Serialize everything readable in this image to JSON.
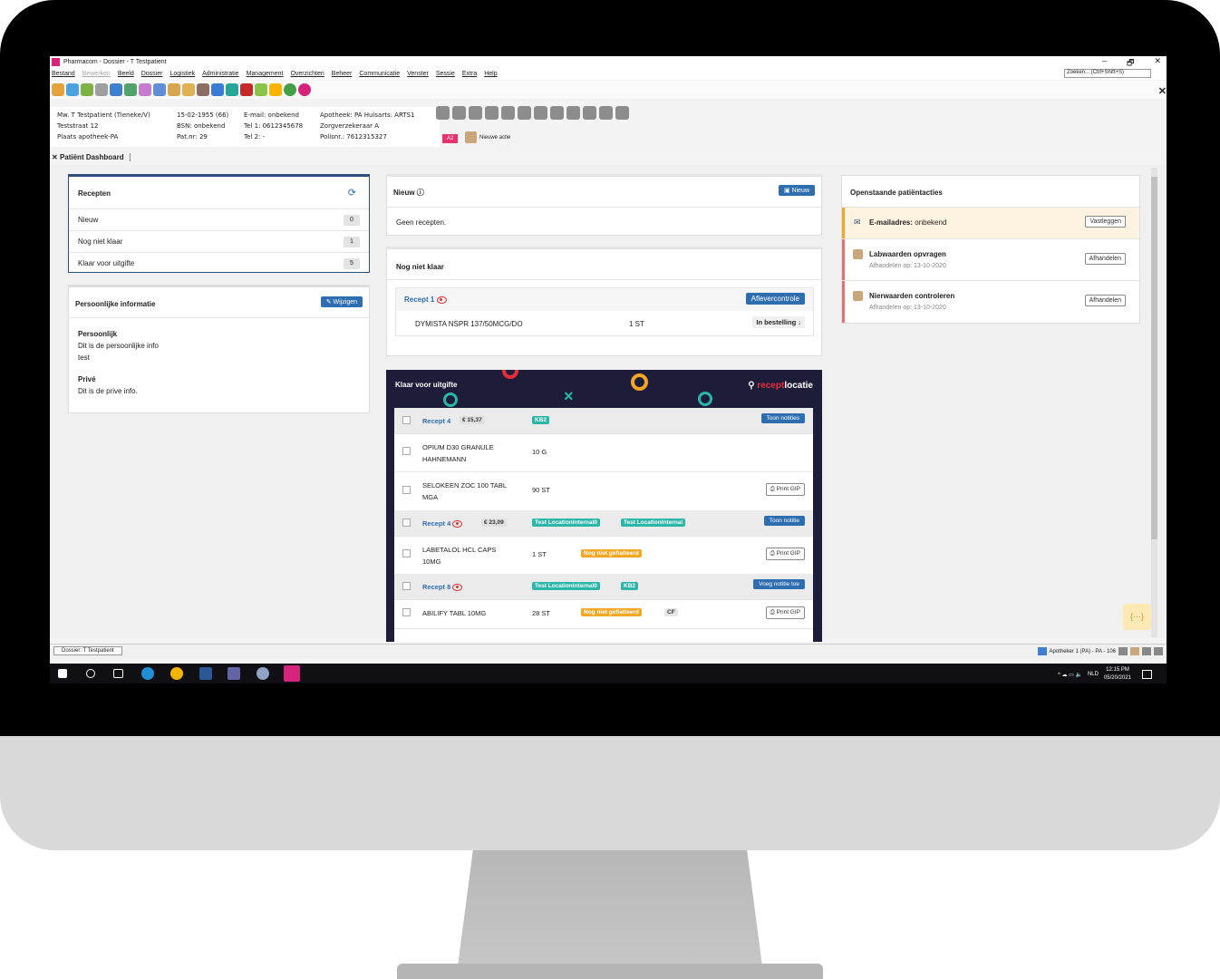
{
  "window": {
    "title": "Pharmacom - Dossier - T Testpatient",
    "min": "–",
    "max": "🗗",
    "close": "✕",
    "close_tab": "✕"
  },
  "menu": [
    "Bestand",
    "Bewerken",
    "Beeld",
    "Dossier",
    "Logistiek",
    "Administratie",
    "Management",
    "Overzichten",
    "Beheer",
    "Communicatie",
    "Venster",
    "Sessie",
    "Extra",
    "Help"
  ],
  "search": {
    "placeholder": "Zoeken... (Ctrl+Shift+S)"
  },
  "patient": {
    "name": "Mw. T Testpatient (Tieneke/V)",
    "street": "Teststraat 12",
    "city": "Plaats apotheek-PA",
    "dob": "15-02-1955 (66)",
    "bsn": "BSN: onbekend",
    "patnr": "Pat.nr: 29",
    "email": "E-mail: onbekend",
    "tel1": "Tel 1: 0612345678",
    "tel2": "Tel 2: -",
    "pharmacy": "Apotheek: PA Huisarts: ARTS1",
    "insurer": "Zorgverzekeraar A",
    "polis": "Polisnr.: 7612315327",
    "badge": "A2",
    "new_action": "Nieuwe actie"
  },
  "tab": {
    "close": "✕",
    "label": "Patiënt Dashboard"
  },
  "recepten": {
    "title": "Recepten",
    "refresh_icon": "⟳",
    "rows": [
      {
        "label": "Nieuw",
        "count": "0"
      },
      {
        "label": "Nog niet klaar",
        "count": "1"
      },
      {
        "label": "Klaar voor uitgifte",
        "count": "5"
      }
    ]
  },
  "personal": {
    "title": "Persoonlijke informatie",
    "edit": "✎ Wijzigen",
    "sec1_title": "Persoonlijk",
    "sec1_line1": "Dit is de persoonlijke info",
    "sec1_line2": "test",
    "sec2_title": "Privé",
    "sec2_line1": "Dit is de prive info."
  },
  "nieuw": {
    "title": "Nieuw ⓘ",
    "button": "▣ Nieuw",
    "empty": "Geen recepten."
  },
  "notready": {
    "title": "Nog niet klaar",
    "recept": "Recept 1",
    "button": "Aflevercontrole",
    "drug": "DYMISTA NSPR 137/50MCG/DO",
    "qty": "1 ST",
    "status": "In bestelling ↓"
  },
  "ready": {
    "title": "Klaar voor uitgifte",
    "brand_a": "recept",
    "brand_b": "locatie",
    "pin": "⚲",
    "rows": {
      "r1": {
        "recept": "Recept 4",
        "price": "€ 15,37",
        "badge": "KB2",
        "btn": "Toon notities"
      },
      "d1": {
        "name1": "OPIUM D30 GRANULE",
        "name2": "HAHNEMANN",
        "qty": "10 G"
      },
      "d2": {
        "name1": "SELOKEEN ZOC 100 TABL",
        "name2": "MGA",
        "qty": "90 ST",
        "btn": "⎙ Print GIP"
      },
      "r2": {
        "recept": "Recept 4",
        "price": "€ 23,09",
        "badge1": "Test LocationInternal0",
        "badge2": "Test LocationInternal",
        "btn": "Toon notitie"
      },
      "d3": {
        "name1": "LABETALOL HCL CAPS",
        "name2": "10MG",
        "qty": "1 ST",
        "status": "Nog niet gefiatteerd",
        "btn": "⎙ Print GIP"
      },
      "r3": {
        "recept": "Recept 8",
        "badge1": "Test LocationInternal0",
        "badge2": "KB2",
        "btn": "Voeg notitie toe"
      },
      "d4": {
        "name1": "ABILIFY TABL 10MG",
        "qty": "28 ST",
        "status": "Nog niet gefiatteerd",
        "cf": "CF",
        "btn": "⎙ Print GIP"
      }
    }
  },
  "actions": {
    "title": "Openstaande patiëntacties",
    "items": [
      {
        "label": "E-mailadres:",
        "value": " onbekend",
        "btn": "Vastleggen",
        "color": "#f5a623"
      },
      {
        "label": "Labwaarden opvragen",
        "sub": "Afhandelen op: 13-10-2020",
        "btn": "Afhandelen",
        "color": "#e8706a"
      },
      {
        "label": "Nierwaarden controleren",
        "sub": "Afhandelen op: 13-10-2020",
        "btn": "Afhandelen",
        "color": "#e8706a"
      }
    ]
  },
  "snippet": "{···}",
  "status": {
    "tab": "Dossier: T Testpatient",
    "right": "Apotheker 1 (PA) - PA - 106"
  },
  "taskbar": {
    "lang": "NLD",
    "time": "12:15 PM",
    "date": "05/20/2021",
    "tray": "^ ☁ ▭ 🔈"
  }
}
